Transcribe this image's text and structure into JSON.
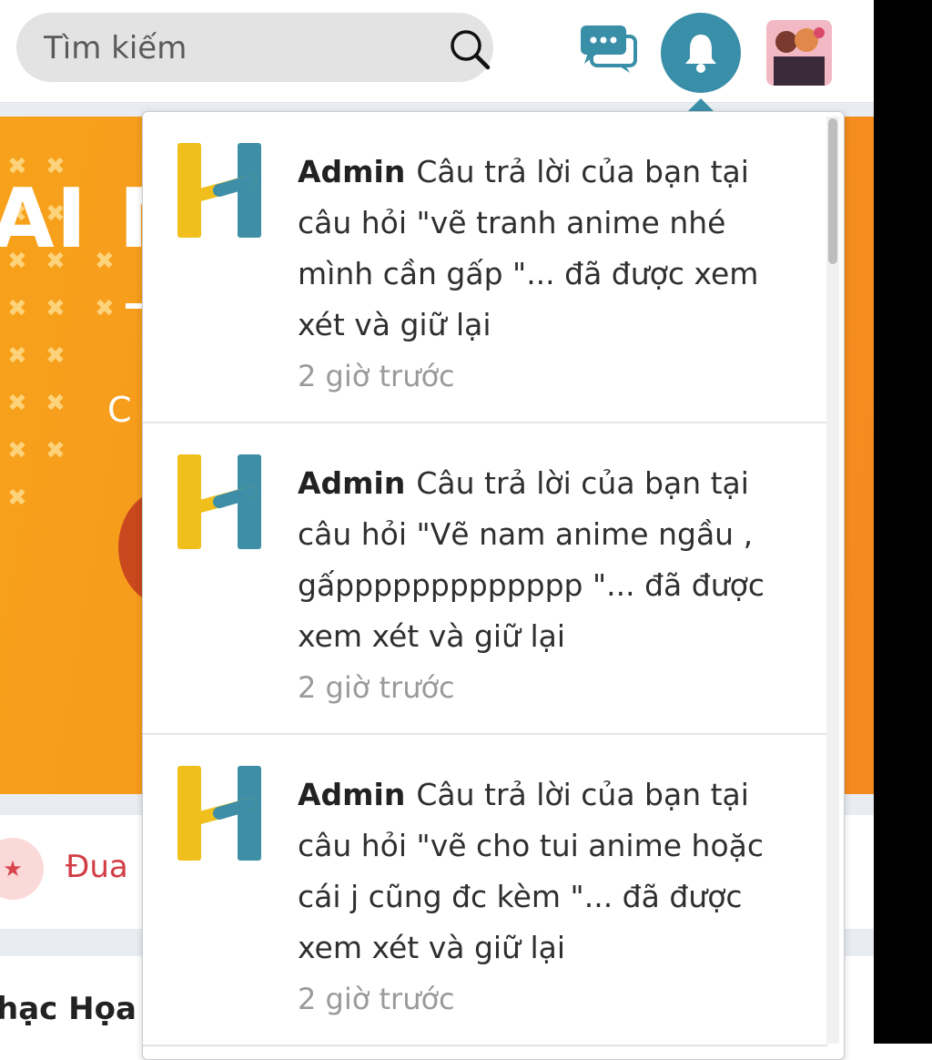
{
  "search": {
    "placeholder": "Tìm kiếm"
  },
  "header": {
    "chat_icon": "chat-bubbles-icon",
    "bell_icon": "bell-icon",
    "avatar": "user-avatar"
  },
  "banner": {
    "title_fragment": "AI MI",
    "subtitle_fragment": "C"
  },
  "below": {
    "race_label": "Đua",
    "category_label": "hạc Họa"
  },
  "notifications": [
    {
      "author": "Admin",
      "message": "Câu trả lời của bạn tại câu hỏi \"vẽ tranh anime nhé mình cần gấp \"... đã được xem xét và giữ lại",
      "time": "2 giờ trước"
    },
    {
      "author": "Admin",
      "message": "Câu trả lời của bạn tại câu hỏi \"Vẽ nam anime ngầu , gấppppppppppppp \"... đã được xem xét và giữ lại",
      "time": "2 giờ trước"
    },
    {
      "author": "Admin",
      "message": "Câu trả lời của bạn tại câu hỏi \"vẽ cho tui anime hoặc cái j cũng đc kèm  \"... đã được xem xét và giữ lại",
      "time": "2 giờ trước"
    }
  ],
  "colors": {
    "accent": "#3a8fa8",
    "banner": "#f6931d",
    "logo_yellow": "#f0bf1c",
    "logo_teal": "#3d8ea6"
  }
}
